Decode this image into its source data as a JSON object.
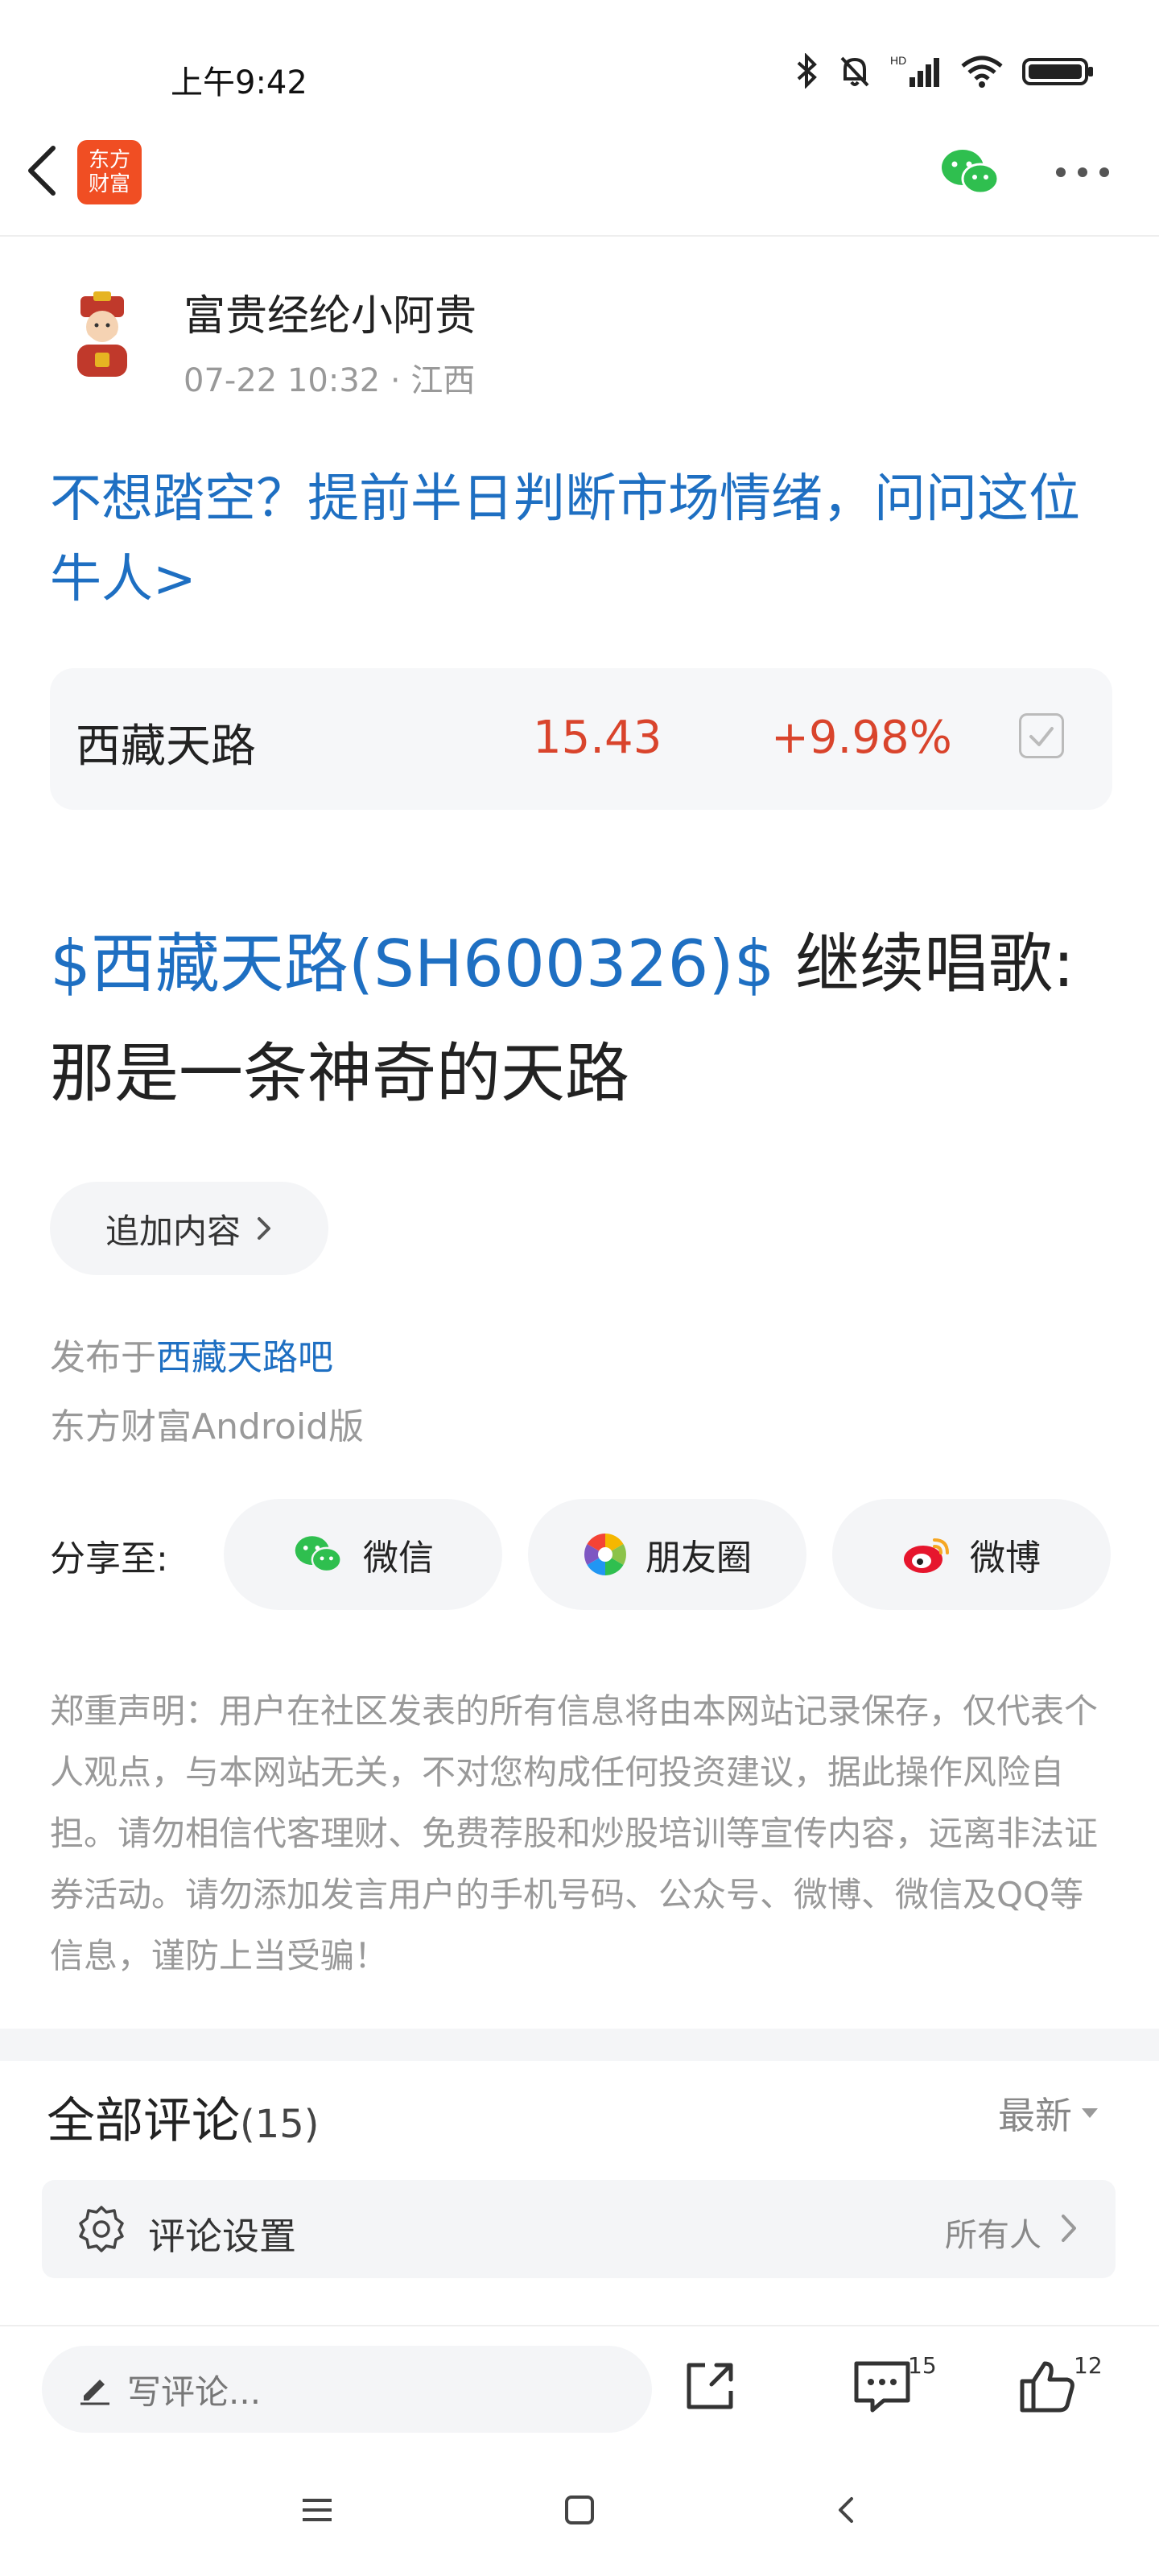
{
  "status_bar": {
    "time": "上午9:42"
  },
  "nav": {
    "logo_line1": "东方",
    "logo_line2": "财富"
  },
  "author": {
    "name": "富贵经纶小阿贵",
    "meta": "07-22 10:32 · 江西"
  },
  "promo": {
    "text": "不想踏空？提前半日判断市场情绪，问问这位牛人>"
  },
  "stock": {
    "name": "西藏天路",
    "price": "15.43",
    "change": "+9.98%"
  },
  "post": {
    "tag": "$西藏天路(SH600326)$",
    "text": " 继续唱歌:那是一条神奇的天路"
  },
  "append_button": {
    "label": "追加内容"
  },
  "published": {
    "prefix": "发布于",
    "forum": "西藏天路吧",
    "source": "东方财富Android版"
  },
  "share": {
    "label": "分享至:",
    "wechat": "微信",
    "moments": "朋友圈",
    "weibo": "微博"
  },
  "disclaimer": "郑重声明：用户在社区发表的所有信息将由本网站记录保存，仅代表个人观点，与本网站无关，不对您构成任何投资建议，据此操作风险自担。请勿相信代客理财、免费荐股和炒股培训等宣传内容，远离非法证券活动。请勿添加发言用户的手机号码、公众号、微博、微信及QQ等信息，谨防上当受骗！",
  "comments": {
    "title": "全部评论",
    "count": "(15)",
    "sort": "最新",
    "settings_label": "评论设置",
    "settings_value": "所有人"
  },
  "bottom_bar": {
    "placeholder": "写评论...",
    "comment_count": "15",
    "like_count": "12"
  },
  "colors": {
    "link_blue": "#1e6fc2",
    "up_red": "#d9442c",
    "brand_orange": "#f04e23",
    "wechat_green": "#2fbf4f"
  }
}
